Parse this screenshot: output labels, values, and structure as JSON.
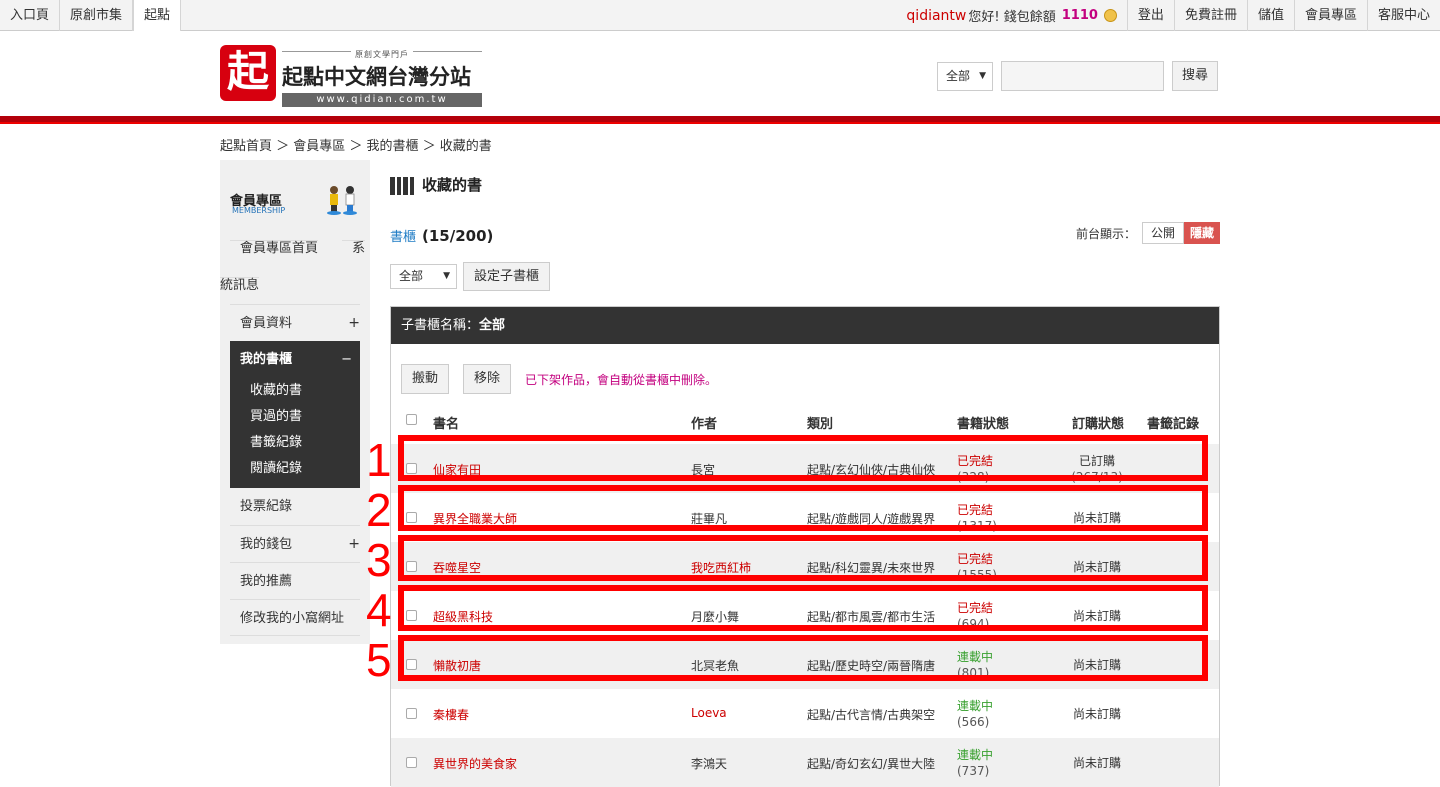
{
  "topbar": {
    "tabs": [
      "入口頁",
      "原創市集",
      "起點"
    ],
    "username": "qidiantw",
    "greeting": "您好! 錢包餘額",
    "balance": "1110",
    "links": [
      "登出",
      "免費註冊",
      "儲值",
      "會員專區",
      "客服中心"
    ]
  },
  "logo": {
    "mark": "起",
    "small": "原創文學門戶",
    "name": "起點中文網台灣分站",
    "url": "www.qidian.com.tw"
  },
  "search": {
    "scope": "全部",
    "button": "搜尋"
  },
  "breadcrumb": "起點首頁 ＞ 會員專區 ＞ 我的書櫃 ＞ 收藏的書",
  "sidebar": {
    "title": "會員專區",
    "subtitle": "MEMBERSHIP",
    "items_top": [
      "會員專區首頁",
      "系統訊息"
    ],
    "member_info": "會員資料",
    "bookshelf": "我的書櫃",
    "bookshelf_sub": [
      "收藏的書",
      "買過的書",
      "書籤紀錄",
      "閱讀紀錄"
    ],
    "items_bottom": [
      "投票紀錄",
      "我的錢包",
      "我的推薦",
      "修改我的小窩網址"
    ]
  },
  "main": {
    "title": "收藏的書",
    "shelf_label": "書櫃",
    "shelf_count": "(15/200)",
    "display_label": "前台顯示：",
    "public": "公開",
    "hidden": "隱藏",
    "sub_select": "全部",
    "set_sub": "設定子書櫃",
    "panel_title_prefix": "子書櫃名稱：",
    "panel_title": "全部",
    "move": "搬動",
    "remove": "移除",
    "note": "已下架作品，會自動從書櫃中刪除。",
    "headers": [
      "書名",
      "作者",
      "類別",
      "書籍狀態",
      "訂購狀態",
      "書籤記錄"
    ]
  },
  "rows": [
    {
      "name": "仙家有田",
      "author": "長宮",
      "category": "起點/玄幻仙俠/古典仙俠",
      "status": "已完結",
      "count": "(328)",
      "buy": "已訂購",
      "buy2": "(267/13)"
    },
    {
      "name": "異界全職業大師",
      "author": "莊畢凡",
      "category": "起點/遊戲同人/遊戲異界",
      "status": "已完結",
      "count": "(1317)",
      "buy": "尚未訂購",
      "buy2": ""
    },
    {
      "name": "吞噬星空",
      "author": "我吃西紅柿",
      "category": "起點/科幻靈異/未來世界",
      "status": "已完結",
      "count": "(1555)",
      "buy": "尚未訂購",
      "buy2": ""
    },
    {
      "name": "超級黑科技",
      "author": "月麼小舞",
      "category": "起點/都市風雲/都市生活",
      "status": "已完結",
      "count": "(694)",
      "buy": "尚未訂購",
      "buy2": ""
    },
    {
      "name": "懶散初唐",
      "author": "北冥老魚",
      "category": "起點/歷史時空/兩晉隋唐",
      "status": "連載中",
      "count": "(801)",
      "buy": "尚未訂購",
      "buy2": ""
    },
    {
      "name": "秦樓春",
      "author": "Loeva",
      "category": "起點/古代言情/古典架空",
      "status": "連載中",
      "count": "(566)",
      "buy": "尚未訂購",
      "buy2": ""
    },
    {
      "name": "異世界的美食家",
      "author": "李鴻天",
      "category": "起點/奇幻玄幻/異世大陸",
      "status": "連載中",
      "count": "(737)",
      "buy": "尚未訂購",
      "buy2": ""
    }
  ],
  "annotations": [
    "1",
    "2",
    "3",
    "4",
    "5"
  ],
  "colors": {
    "brand_red": "#d7000f",
    "highlight": "#ff0000",
    "serial": "#38a02f",
    "pink_note": "#c3007f"
  }
}
